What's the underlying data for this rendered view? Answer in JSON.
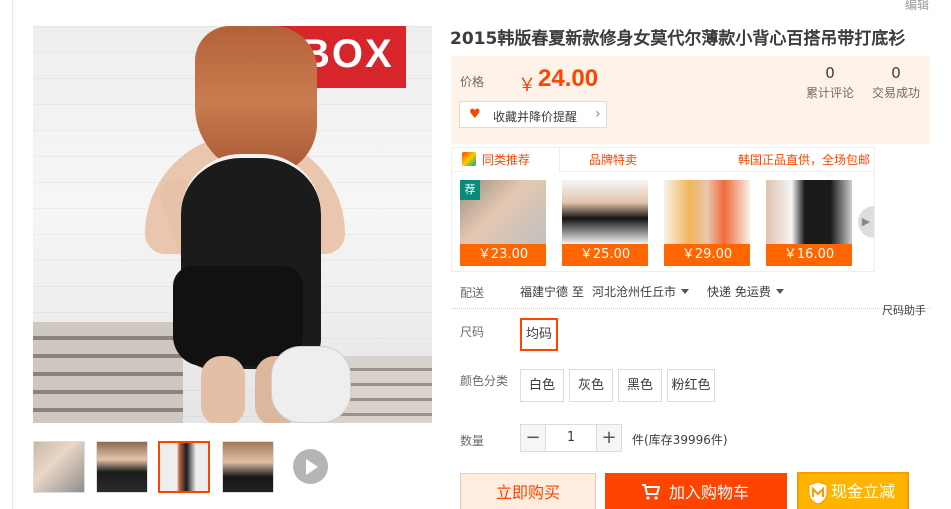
{
  "edit_link": "编辑",
  "product": {
    "title": "2015韩版春夏新款修身女莫代尔薄款小背心百搭吊带打底衫",
    "main_photo_sign_text": "BOX"
  },
  "price": {
    "label": "价格",
    "currency": "￥",
    "value": "24.00"
  },
  "stats": {
    "reviews_count": "0",
    "reviews_label": "累计评论",
    "sales_count": "0",
    "sales_label": "交易成功"
  },
  "favorite_button": {
    "icon": "heart-icon",
    "label": "收藏并降价提醒"
  },
  "recommend": {
    "tab_similar": "同类推荐",
    "tab_brand": "品牌特卖",
    "promo": "韩国正品直供，全场包邮",
    "badge": "荐",
    "items": [
      {
        "price": "￥23.00"
      },
      {
        "price": "￥25.00"
      },
      {
        "price": "￥29.00"
      },
      {
        "price": "￥16.00"
      }
    ]
  },
  "delivery": {
    "label": "配送",
    "from": "福建宁德 至",
    "to": "河北沧州任丘市",
    "shipping": "快递 免运费"
  },
  "size_helper": "尺码助手",
  "size": {
    "label": "尺码",
    "options": [
      "均码"
    ]
  },
  "color": {
    "label": "颜色分类",
    "options": [
      "白色",
      "灰色",
      "黑色",
      "粉红色"
    ]
  },
  "quantity": {
    "label": "数量",
    "minus": "−",
    "value": "1",
    "plus": "+",
    "stock_text": "件(库存39996件)"
  },
  "actions": {
    "buy_now": "立即购买",
    "add_to_cart": "加入购物车",
    "cash_now": "现金立减"
  },
  "colors": {
    "accent": "#ff4400",
    "price_bg": "#fff2e8",
    "cash_btn": "#ffb400"
  }
}
